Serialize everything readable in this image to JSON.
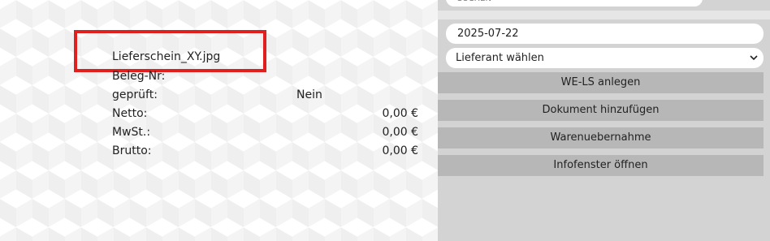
{
  "document": {
    "filename": "Lieferschein_XY.jpg",
    "rows": [
      {
        "label": "Beleg-Nr:",
        "value": "",
        "align": "right"
      },
      {
        "label": "geprüft:",
        "value": "Nein",
        "align": "mid"
      },
      {
        "label": "Netto:",
        "value": "0,00 €",
        "align": "right"
      },
      {
        "label": "MwSt.:",
        "value": "0,00 €",
        "align": "right"
      },
      {
        "label": "Brutto:",
        "value": "0,00 €",
        "align": "right"
      }
    ]
  },
  "panel": {
    "search_placeholder": "SUCHEN",
    "date_value": "2025-07-22",
    "supplier_select": "Lieferant wählen",
    "buttons": [
      "WE-LS anlegen",
      "Dokument hinzufügen",
      "Warenuebernahme",
      "Infofenster öffnen"
    ]
  },
  "colors": {
    "highlight": "#e0201f",
    "panel_bg": "#d3d3d3",
    "button_bg": "#b7b7b7"
  }
}
